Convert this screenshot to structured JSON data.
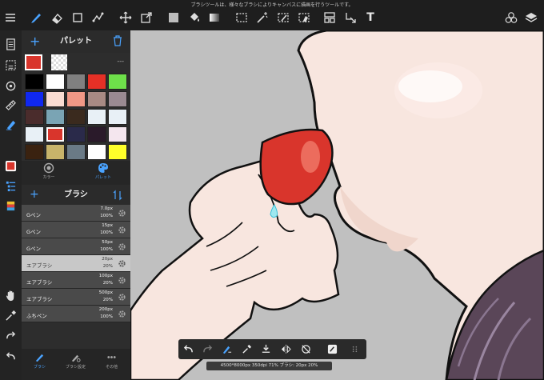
{
  "hint": "ブラシツールは、様々なブラシによりキャンバスに描画を行うツールです。",
  "palette": {
    "title": "パレット",
    "more": "---",
    "current_color": "#d9352c",
    "swatches": [
      "#000000",
      "#ffffff",
      "#808080",
      "#e53026",
      "#6ee04a",
      "#1028f0",
      "#f9dcd2",
      "#f09886",
      "#a88a84",
      "#9a8a92",
      "#4a2c2c",
      "#7aa4b4",
      "#3a2a1e",
      "#e8f0f6",
      "#e8f0f6",
      "#e8f0f6",
      "#d9352c",
      "#2a2a4a",
      "#2a1a2a",
      "#f4e6ee",
      "#3a2210",
      "#c8b46a",
      "#6a7a86",
      "#ffffff",
      "#ffff2a",
      "#ee3af0",
      "#6af0f0",
      "#7a8288",
      "#ffffff",
      "#ffffff"
    ],
    "selected_index": 16,
    "tab_color": "カラー",
    "tab_palette": "パレット"
  },
  "brush": {
    "title": "ブラシ",
    "items": [
      {
        "name": "Gペン",
        "size": "7.0px",
        "opacity": "100%"
      },
      {
        "name": "Gペン",
        "size": "15px",
        "opacity": "100%"
      },
      {
        "name": "Gペン",
        "size": "50px",
        "opacity": "100%"
      },
      {
        "name": "エアブラシ",
        "size": "20px",
        "opacity": "20%"
      },
      {
        "name": "エアブラシ",
        "size": "100px",
        "opacity": "20%"
      },
      {
        "name": "エアブラシ",
        "size": "500px",
        "opacity": "20%"
      },
      {
        "name": "ふちペン",
        "size": "200px",
        "opacity": "100%"
      }
    ],
    "selected_index": 3
  },
  "bottom_tabs": [
    "ブラシ",
    "ブラシ設定",
    "その他"
  ],
  "status": "4500*8000px 350dpi 71% ブラシ: 20px 20%",
  "colors": {
    "accent": "#4aa3ff",
    "canvas_bg": "#c0c0c0",
    "skin": "#f8e6df",
    "hair": "#5a4658"
  }
}
